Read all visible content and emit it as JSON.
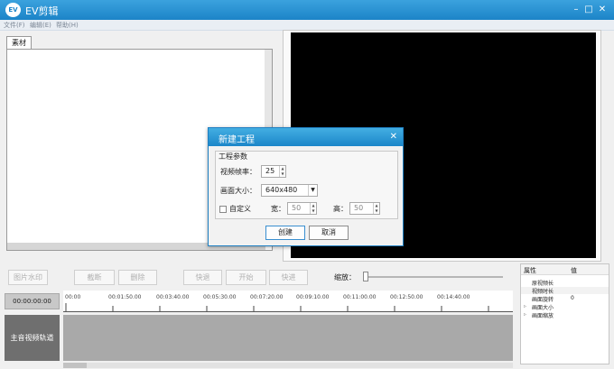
{
  "app": {
    "title": "EV剪辑",
    "logo_text": "EV"
  },
  "window_controls": {
    "minimize": "–",
    "maximize": "□",
    "close": "✕"
  },
  "menu": [
    {
      "label": "文件(F)"
    },
    {
      "label": "编辑(E)"
    },
    {
      "label": "帮助(H)"
    }
  ],
  "media": {
    "tab_label": "素材"
  },
  "toolbar": {
    "watermark": "图片水印",
    "cut": "截断",
    "delete": "删除",
    "rewind": "快退",
    "play": "开始",
    "forward": "快进",
    "zoom_label": "缩放："
  },
  "timeline": {
    "current_time": "00:00:00:00",
    "ticks": [
      "00:00",
      "00:01:50.00",
      "00:03:40.00",
      "00:05:30.00",
      "00:07:20.00",
      "00:09:10.00",
      "00:11:00.00",
      "00:12:50.00",
      "00:14:40.00"
    ],
    "track_label": "主音视频轨道"
  },
  "properties": {
    "header_name": "属性",
    "header_value": "值",
    "rows": [
      {
        "label": "原视频长",
        "value": ""
      },
      {
        "label": "视频时长",
        "value": ""
      },
      {
        "label": "画面旋转",
        "value": "0"
      },
      {
        "label": "画面大小",
        "value": ""
      },
      {
        "label": "画面缩放",
        "value": ""
      }
    ]
  },
  "dialog": {
    "title": "新建工程",
    "group_title": "工程参数",
    "frame_rate_label": "视频帧率：",
    "frame_rate_value": "25",
    "size_label": "画面大小：",
    "size_value": "640x480",
    "custom_label": "自定义",
    "width_label": "宽：",
    "width_value": "50",
    "height_label": "高：",
    "height_value": "50",
    "create_button": "创建",
    "cancel_button": "取消"
  },
  "colors": {
    "titlebar": "#1c84c8",
    "preview": "#000000",
    "track": "#a9a9a9",
    "track_label": "#6f6f6f"
  }
}
